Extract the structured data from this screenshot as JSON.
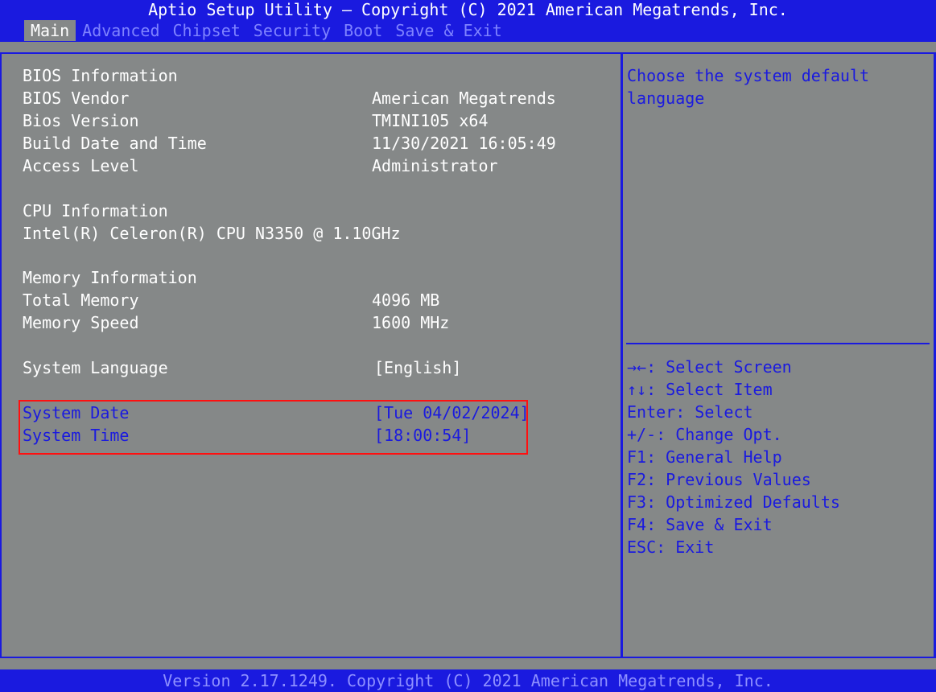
{
  "header": {
    "title": "Aptio Setup Utility – Copyright (C) 2021 American Megatrends, Inc.",
    "tabs": [
      {
        "label": "Main",
        "active": true
      },
      {
        "label": "Advanced",
        "active": false
      },
      {
        "label": "Chipset",
        "active": false
      },
      {
        "label": "Security",
        "active": false
      },
      {
        "label": "Boot",
        "active": false
      },
      {
        "label": "Save & Exit",
        "active": false
      }
    ]
  },
  "main": {
    "bios_section": "BIOS Information",
    "bios_vendor_label": "BIOS Vendor",
    "bios_vendor_value": "American Megatrends",
    "bios_version_label": "Bios Version",
    "bios_version_value": "TMINI105 x64",
    "build_date_label": "Build Date and Time",
    "build_date_value": "11/30/2021 16:05:49",
    "access_level_label": "Access Level",
    "access_level_value": "Administrator",
    "cpu_section": "CPU Information",
    "cpu_model": "Intel(R) Celeron(R) CPU N3350 @ 1.10GHz",
    "memory_section": "Memory Information",
    "total_memory_label": "Total Memory",
    "total_memory_value": "4096 MB",
    "memory_speed_label": "Memory Speed",
    "memory_speed_value": "1600 MHz",
    "system_language_label": "System Language",
    "system_language_value": "[English]",
    "system_date_label": "System Date",
    "system_date_value": "[Tue 04/02/2024]",
    "system_time_label": "System Time",
    "system_time_value": "[18:00:54]"
  },
  "help": {
    "description": "Choose the system default language",
    "keys": [
      "→←: Select Screen",
      "↑↓: Select Item",
      "Enter: Select",
      "+/-: Change Opt.",
      "F1: General Help",
      "F2: Previous Values",
      "F3: Optimized Defaults",
      "F4: Save & Exit",
      "ESC: Exit"
    ]
  },
  "footer": {
    "text": "Version 2.17.1249. Copyright (C) 2021 American Megatrends, Inc."
  },
  "colors": {
    "background": "#858888",
    "frame_blue": "#1a1adf",
    "highlight_red": "#ff1010",
    "inactive_tab": "#7f83ff"
  }
}
